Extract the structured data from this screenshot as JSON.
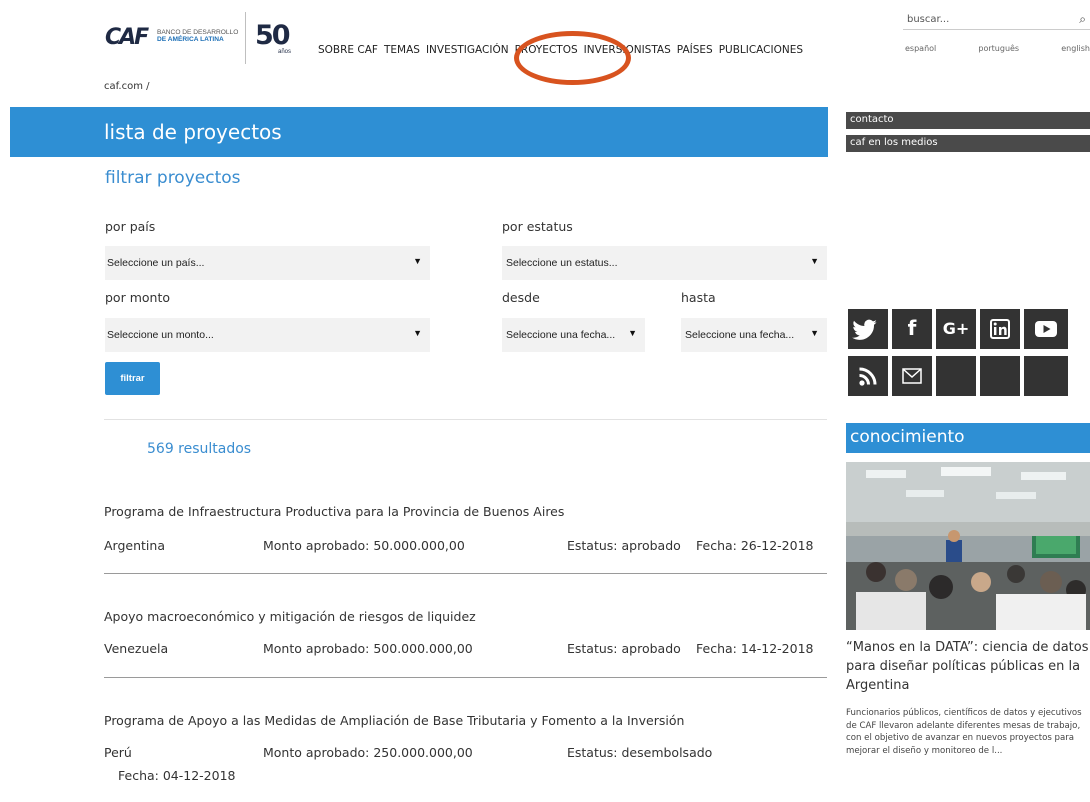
{
  "header": {
    "logo_caf": "CAF",
    "logo_bank_line1": "BANCO DE DESARROLLO",
    "logo_bank_line2": "DE AMÉRICA LATINA",
    "logo_50": "50",
    "logo_anos": "años",
    "nav": [
      "SOBRE CAF",
      "TEMAS",
      "INVESTIGACIÓN",
      "PROYECTOS",
      "INVERSIONISTAS",
      "PAÍSES",
      "PUBLICACIONES"
    ],
    "highlighted_nav": "PROYECTOS",
    "highlight_color": "#d8531f",
    "search_placeholder": "buscar...",
    "search_icon": "search-icon",
    "languages": [
      "español",
      "português",
      "english"
    ]
  },
  "breadcrumb": "caf.com /",
  "page_title": "lista de proyectos",
  "filters": {
    "heading": "filtrar proyectos",
    "pais_label": "por país",
    "pais_value": "Seleccione un país...",
    "estatus_label": "por estatus",
    "estatus_value": "Seleccione un estatus...",
    "monto_label": "por monto",
    "monto_value": "Seleccione un monto...",
    "desde_label": "desde",
    "desde_value": "Seleccione una fecha...",
    "hasta_label": "hasta",
    "hasta_value": "Seleccione una fecha...",
    "button": "filtrar"
  },
  "results_count": "569 resultados",
  "projects": [
    {
      "title": "Programa de Infraestructura Productiva para la Provincia de Buenos Aires",
      "country": "Argentina",
      "amount": "Monto aprobado: 50.000.000,00",
      "status": "Estatus: aprobado",
      "date": "Fecha: 26-12-2018"
    },
    {
      "title": "Apoyo macroeconómico y mitigación de riesgos de liquidez",
      "country": "Venezuela",
      "amount": "Monto aprobado: 500.000.000,00",
      "status": "Estatus: aprobado",
      "date": "Fecha: 14-12-2018"
    },
    {
      "title": "Programa de Apoyo a las Medidas de Ampliación de Base Tributaria y Fomento a la Inversión",
      "country": "Perú",
      "amount": "Monto aprobado: 250.000.000,00",
      "status": "Estatus: desembolsado",
      "date": "Fecha: 04-12-2018"
    }
  ],
  "sidebar": {
    "links": [
      "contacto",
      "caf en los medios"
    ],
    "social": [
      {
        "icon": "twitter-icon",
        "glyph": "🐦"
      },
      {
        "icon": "facebook-icon",
        "glyph": "f"
      },
      {
        "icon": "google-plus-icon",
        "glyph": "G+"
      },
      {
        "icon": "linkedin-icon",
        "glyph": "in"
      },
      {
        "icon": "youtube-icon",
        "glyph": "▶"
      },
      {
        "icon": "rss-icon",
        "glyph": "⋰"
      },
      {
        "icon": "mail-icon",
        "glyph": "✉"
      }
    ],
    "knowledge_heading": "conocimiento",
    "article_title": "“Manos en la DATA”: ciencia de datos para diseñar políticas públicas en la Argentina",
    "article_excerpt": "Funcionarios públicos, científicos de datos y ejecutivos de CAF llevaron adelante diferentes mesas de trabajo, con el objetivo de avanzar en nuevos proyectos para mejorar el diseño y monitoreo de l..."
  }
}
